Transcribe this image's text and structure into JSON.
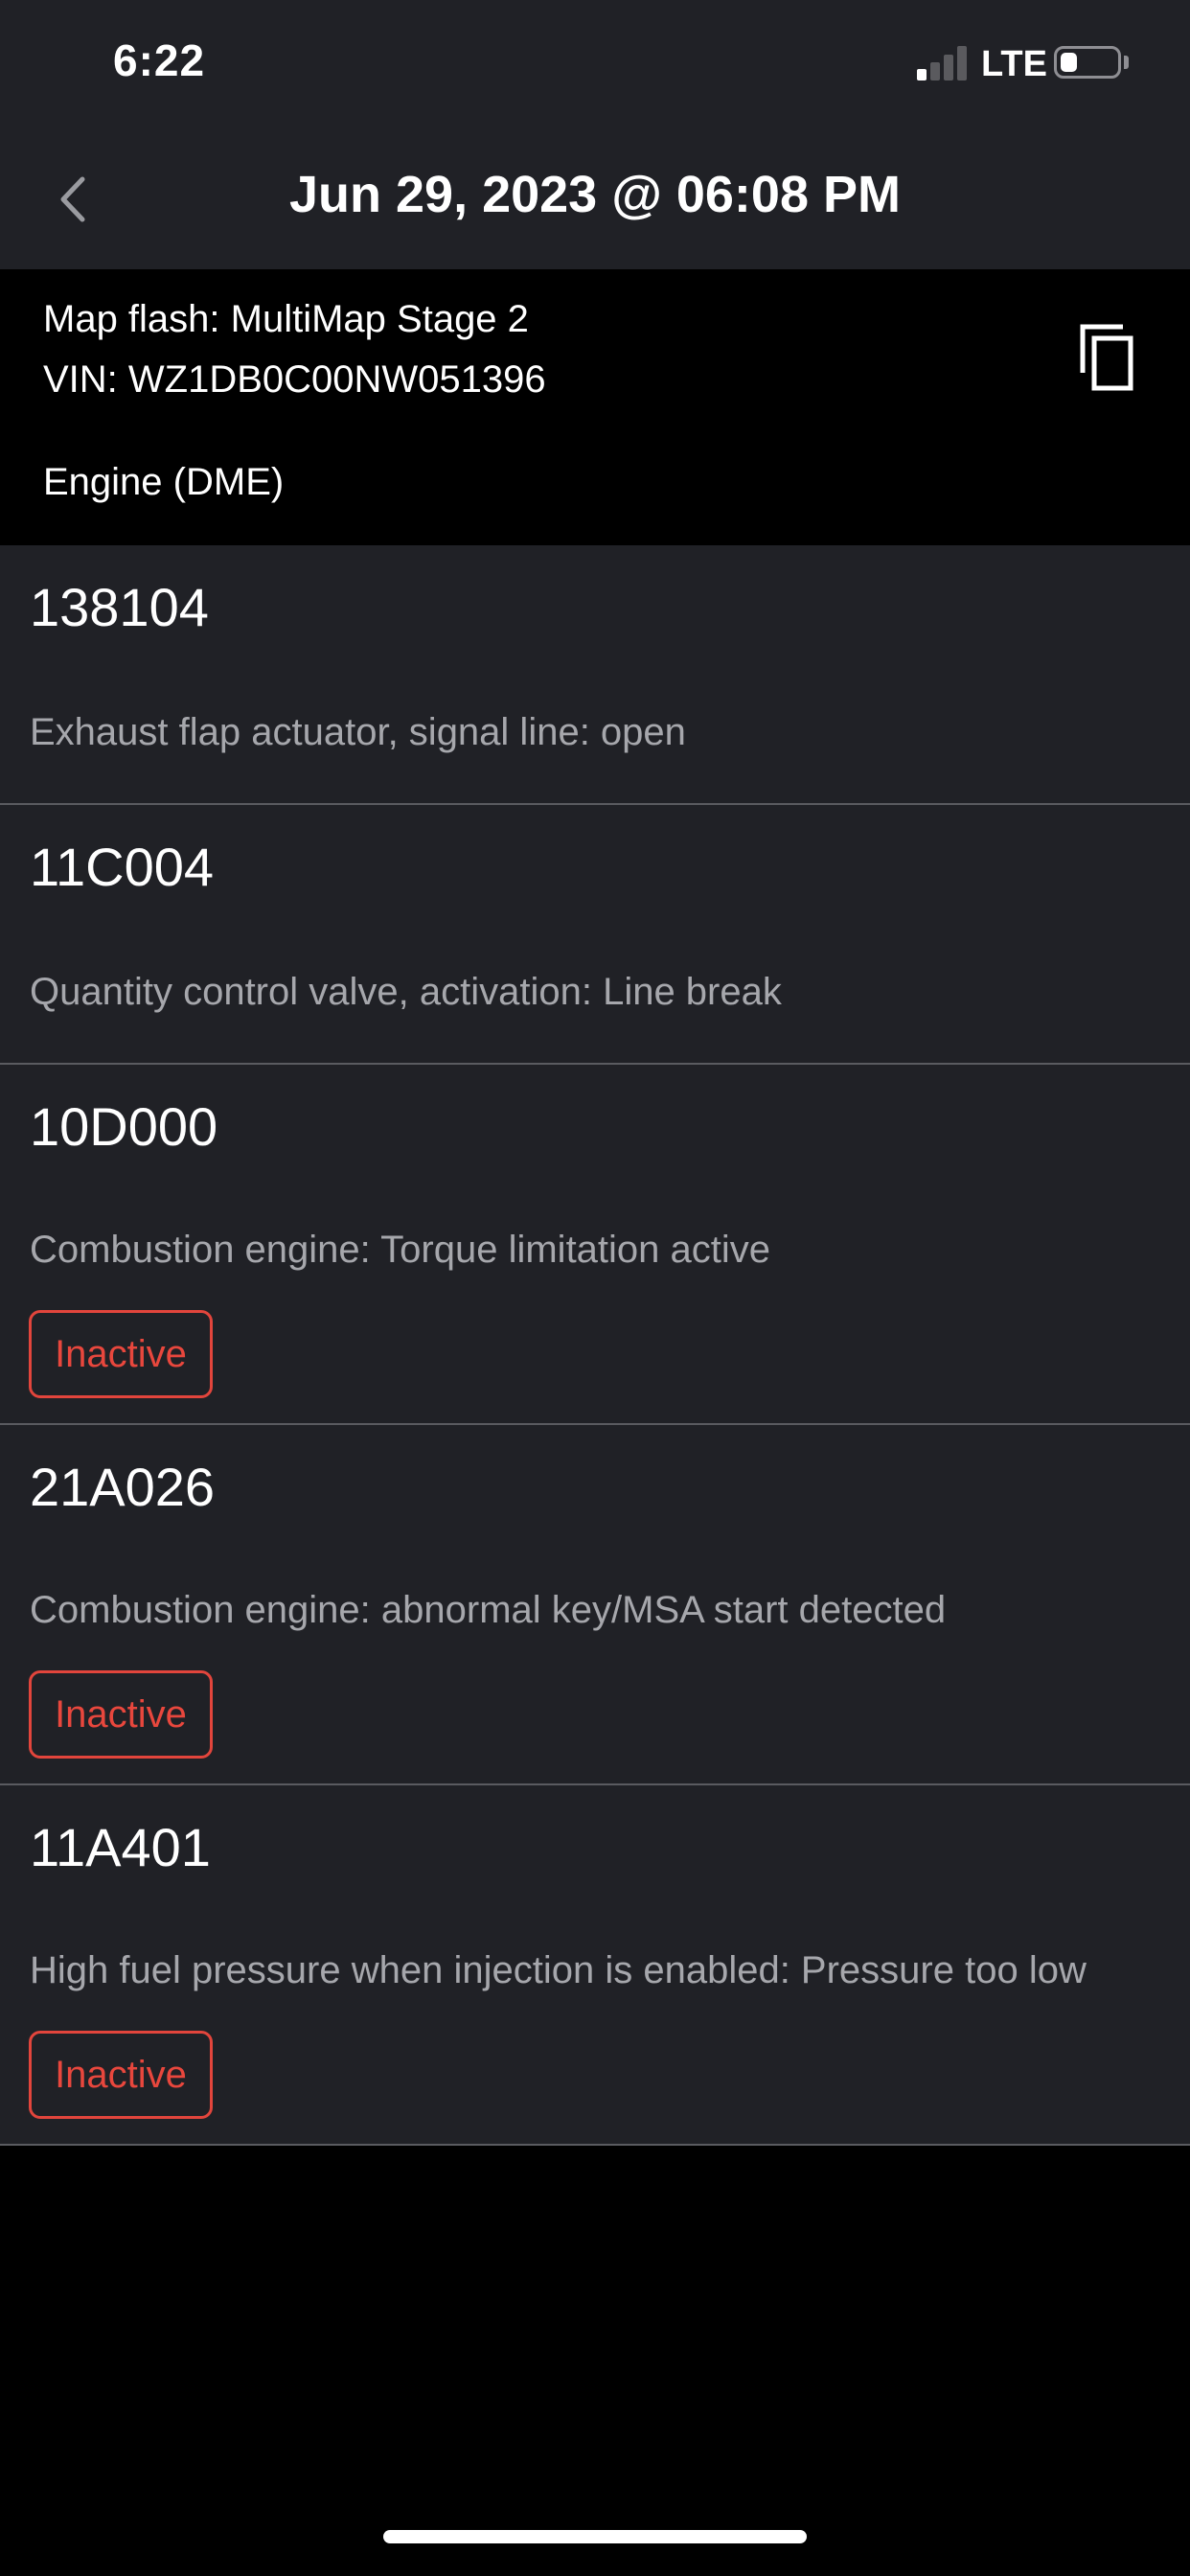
{
  "status_bar": {
    "time": "6:22",
    "network": "LTE",
    "signal_bars_active": 1,
    "signal_bars_total": 4,
    "battery_level": 0.3
  },
  "nav": {
    "back_icon": "chevron-left-icon",
    "title": "Jun 29, 2023 @ 06:08 PM"
  },
  "info": {
    "map_flash": "Map flash: MultiMap Stage 2",
    "vin": "VIN: WZ1DB0C00NW051396",
    "module": "Engine (DME)",
    "copy_icon": "copy-icon"
  },
  "faults": [
    {
      "code": "138104",
      "description": "Exhaust flap actuator, signal line: open",
      "status": ""
    },
    {
      "code": "11C004",
      "description": "Quantity control valve, activation: Line break",
      "status": ""
    },
    {
      "code": "10D000",
      "description": "Combustion engine: Torque limitation active",
      "status": "Inactive"
    },
    {
      "code": "21A026",
      "description": "Combustion engine: abnormal key/MSA start detected",
      "status": "Inactive"
    },
    {
      "code": "11A401",
      "description": "High fuel pressure when injection is enabled: Pressure too low",
      "status": "Inactive"
    }
  ],
  "colors": {
    "background": "#000000",
    "card": "#202126",
    "divider": "#5a5b60",
    "text_primary": "#ffffff",
    "text_secondary": "#a6a7ac",
    "status_inactive": "#e8473d"
  }
}
